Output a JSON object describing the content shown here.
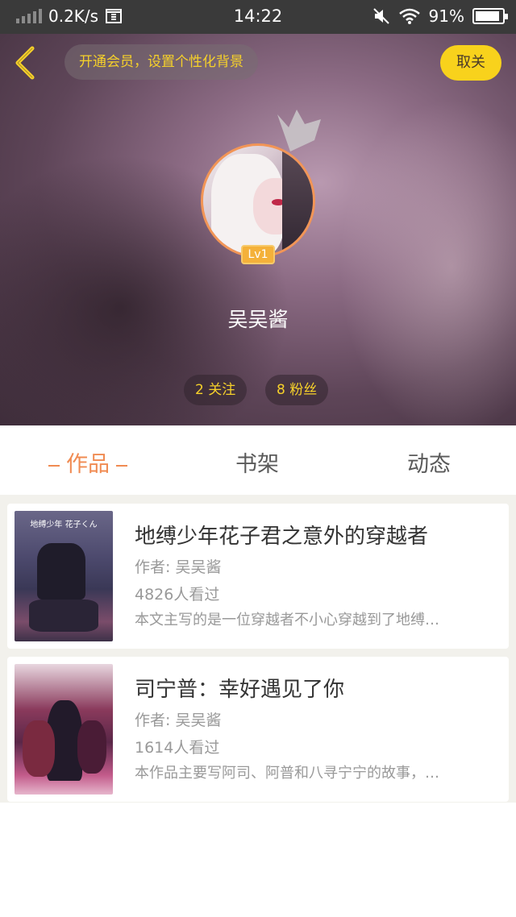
{
  "status_bar": {
    "net_speed": "0.2K/s",
    "time": "14:22",
    "battery": "91%",
    "battery_level": 0.91
  },
  "header": {
    "vip_prompt": "开通会员，设置个性化背景",
    "unfollow_label": "取关",
    "level": "Lv1",
    "username": "吴吴酱",
    "following": "2 关注",
    "followers": "8 粉丝"
  },
  "tabs": [
    {
      "label": "作品",
      "active": true
    },
    {
      "label": "书架",
      "active": false
    },
    {
      "label": "动态",
      "active": false
    }
  ],
  "books": [
    {
      "title": "地缚少年花子君之意外的穿越者",
      "author": "作者: 吴吴酱",
      "views": "4826人看过",
      "description": "本文主写的是一位穿越者不小心穿越到了地缚…",
      "cover_text": "地缚少年 花子くん"
    },
    {
      "title": "司宁普：幸好遇见了你",
      "author": "作者: 吴吴酱",
      "views": "1614人看过",
      "description": "本作品主要写阿司、阿普和八寻宁宁的故事，…"
    }
  ],
  "colors": {
    "accent": "#f08b52",
    "yellow": "#f8d21c",
    "status_bar": "#3a3a3a"
  }
}
